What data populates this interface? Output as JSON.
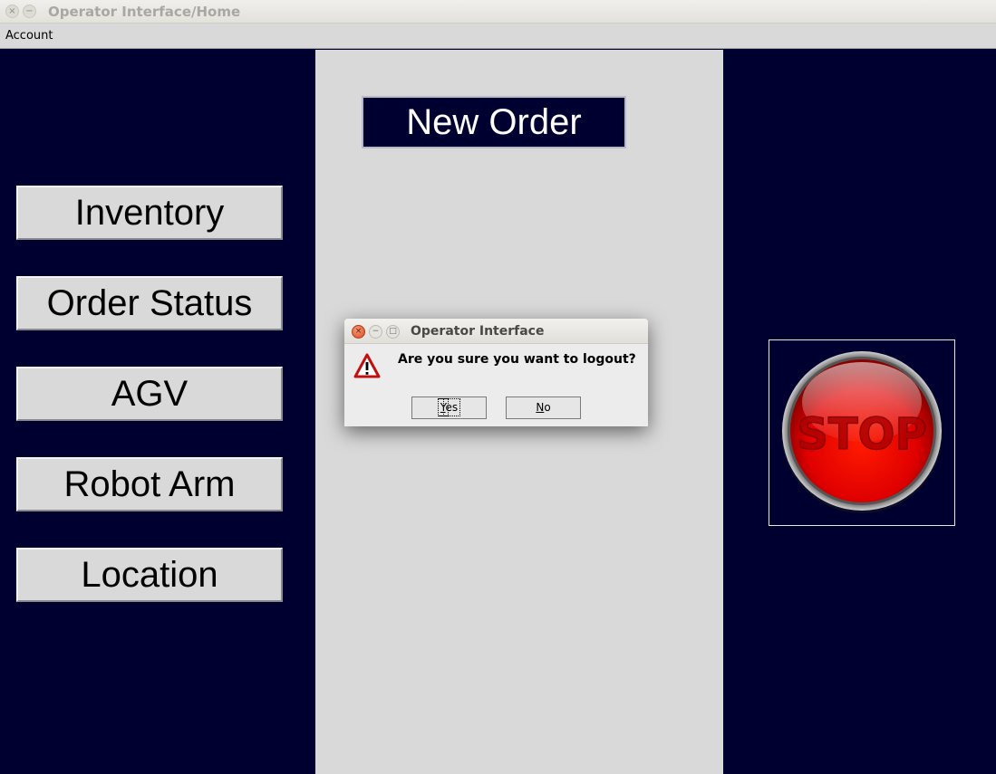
{
  "window": {
    "title": "Operator Interface/Home",
    "close_glyph": "×",
    "minimize_glyph": "−"
  },
  "menubar": {
    "items": [
      "Account"
    ]
  },
  "sidebar": {
    "buttons": [
      "Inventory",
      "Order Status",
      "AGV",
      "Robot Arm",
      "Location"
    ]
  },
  "center": {
    "new_order_label": "New Order"
  },
  "stop_button": {
    "label": "STOP",
    "color": "#e80000"
  },
  "dialog": {
    "title": "Operator Interface",
    "message": "Are you sure you want to logout?",
    "yes_mnemonic": "Y",
    "yes_rest": "es",
    "no_mnemonic": "N",
    "no_rest": "o",
    "close_glyph": "×",
    "minimize_glyph": "−",
    "maximize_glyph": "□",
    "icon": "warning-icon"
  },
  "colors": {
    "panel_dark": "#000030",
    "panel_light": "#d9d9d9"
  }
}
